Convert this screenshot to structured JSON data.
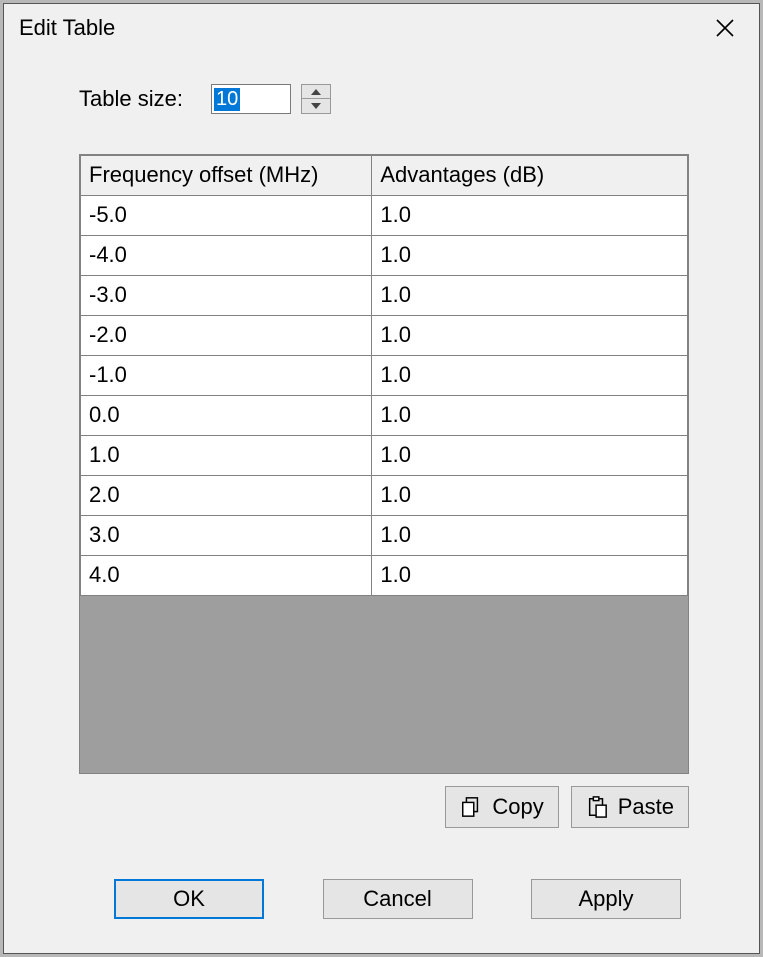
{
  "window": {
    "title": "Edit Table"
  },
  "size": {
    "label": "Table size:",
    "value": "10"
  },
  "table": {
    "headers": [
      "Frequency offset (MHz)",
      "Advantages (dB)"
    ],
    "rows": [
      {
        "freq": "-5.0",
        "adv": "1.0"
      },
      {
        "freq": "-4.0",
        "adv": "1.0"
      },
      {
        "freq": "-3.0",
        "adv": "1.0"
      },
      {
        "freq": "-2.0",
        "adv": "1.0"
      },
      {
        "freq": "-1.0",
        "adv": "1.0"
      },
      {
        "freq": "0.0",
        "adv": "1.0"
      },
      {
        "freq": "1.0",
        "adv": "1.0"
      },
      {
        "freq": "2.0",
        "adv": "1.0"
      },
      {
        "freq": "3.0",
        "adv": "1.0"
      },
      {
        "freq": "4.0",
        "adv": "1.0"
      }
    ]
  },
  "buttons": {
    "copy": "Copy",
    "paste": "Paste",
    "ok": "OK",
    "cancel": "Cancel",
    "apply": "Apply"
  }
}
